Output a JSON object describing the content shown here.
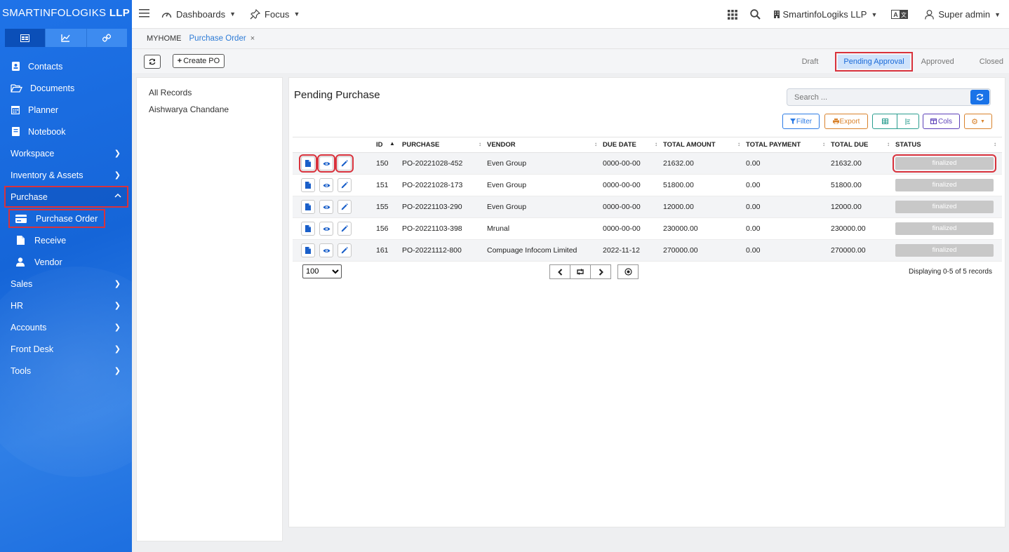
{
  "brand": {
    "name_light": "SMARTINFOLOGIKS",
    "name_bold": "LLP"
  },
  "sidebar": {
    "tabs": [
      {
        "icon": "dashboard-icon",
        "active": true
      },
      {
        "icon": "chart-icon",
        "active": false
      },
      {
        "icon": "link-icon",
        "active": false
      }
    ],
    "items": [
      {
        "label": "Contacts",
        "icon": "contact-book-icon"
      },
      {
        "label": "Documents",
        "icon": "folder-open-icon"
      },
      {
        "label": "Planner",
        "icon": "calendar-icon"
      },
      {
        "label": "Notebook",
        "icon": "notebook-icon"
      },
      {
        "label": "Workspace"
      },
      {
        "label": "Inventory & Assets"
      },
      {
        "label": "Purchase",
        "expanded": true
      },
      {
        "label": "Purchase Order",
        "icon": "credit-card-icon"
      },
      {
        "label": "Receive",
        "icon": "file-icon"
      },
      {
        "label": "Vendor",
        "icon": "user-icon"
      },
      {
        "label": "Sales"
      },
      {
        "label": "HR"
      },
      {
        "label": "Accounts"
      },
      {
        "label": "Front Desk"
      },
      {
        "label": "Tools"
      }
    ]
  },
  "topbar": {
    "dashboards": "Dashboards",
    "focus": "Focus",
    "company": "SmartinfoLogiks LLP",
    "user": "Super admin"
  },
  "breadcrumb": {
    "home": "MYHOME",
    "current": "Purchase Order",
    "close": "×"
  },
  "toolbar": {
    "create_label": "Create PO",
    "status_tabs": [
      "Draft",
      "Pending Approval",
      "Approved",
      "Closed"
    ],
    "active_status": "Pending Approval"
  },
  "left_panel": {
    "items": [
      "All Records",
      "Aishwarya Chandane"
    ]
  },
  "main": {
    "title": "Pending Purchase",
    "search_placeholder": "Search ...",
    "buttons": {
      "filter": "Filter",
      "export": "Export",
      "cols": "Cols"
    },
    "table": {
      "columns": [
        "ID",
        "PURCHASE",
        "VENDOR",
        "DUE DATE",
        "TOTAL AMOUNT",
        "TOTAL PAYMENT",
        "TOTAL DUE",
        "STATUS"
      ],
      "rows": [
        {
          "id": "150",
          "purchase": "PO-20221028-452",
          "vendor": "Even Group",
          "due_date": "0000-00-00",
          "total_amount": "21632.00",
          "total_payment": "0.00",
          "total_due": "21632.00",
          "status": "finalized"
        },
        {
          "id": "151",
          "purchase": "PO-20221028-173",
          "vendor": "Even Group",
          "due_date": "0000-00-00",
          "total_amount": "51800.00",
          "total_payment": "0.00",
          "total_due": "51800.00",
          "status": "finalized"
        },
        {
          "id": "155",
          "purchase": "PO-20221103-290",
          "vendor": "Even Group",
          "due_date": "0000-00-00",
          "total_amount": "12000.00",
          "total_payment": "0.00",
          "total_due": "12000.00",
          "status": "finalized"
        },
        {
          "id": "156",
          "purchase": "PO-20221103-398",
          "vendor": "Mrunal",
          "due_date": "0000-00-00",
          "total_amount": "230000.00",
          "total_payment": "0.00",
          "total_due": "230000.00",
          "status": "finalized"
        },
        {
          "id": "161",
          "purchase": "PO-20221112-800",
          "vendor": "Compuage Infocom Limited",
          "due_date": "2022-11-12",
          "total_amount": "270000.00",
          "total_payment": "0.00",
          "total_due": "270000.00",
          "status": "finalized"
        }
      ]
    },
    "pager": {
      "page_size": "100",
      "info": "Displaying 0-5 of 5 records"
    }
  },
  "colors": {
    "accent": "#1a73e8",
    "highlight": "#d8323c",
    "status_pill": "#c8c8c8"
  }
}
